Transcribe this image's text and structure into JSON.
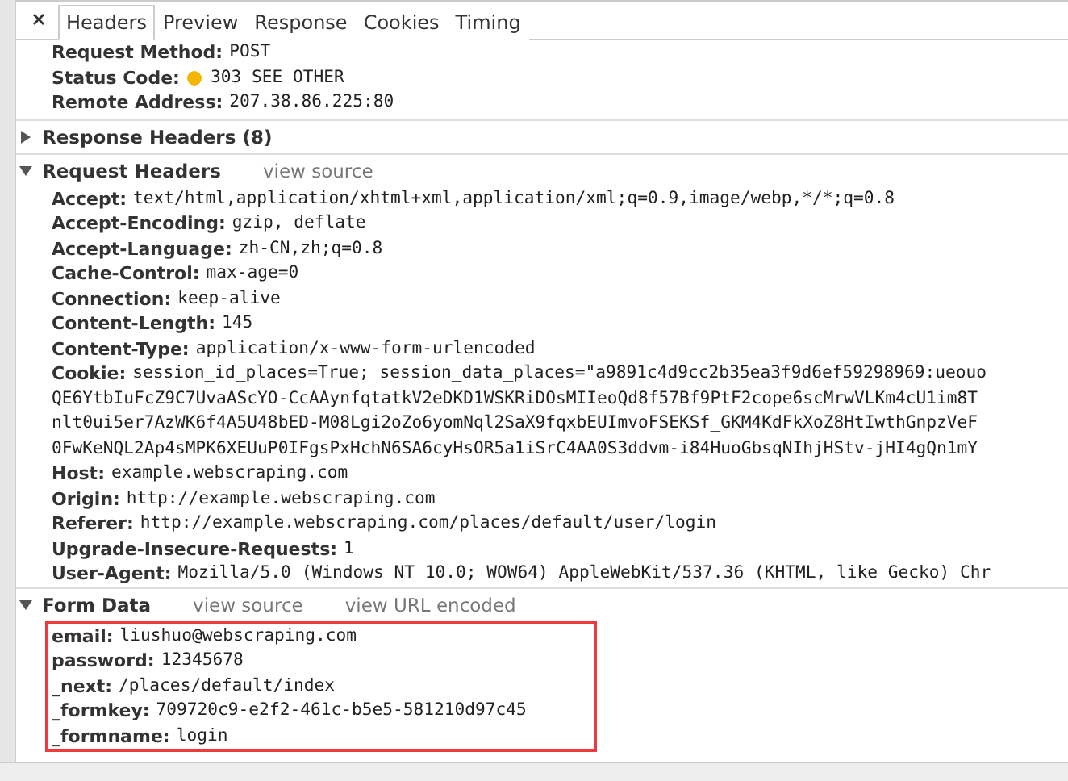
{
  "tabs": [
    {
      "label": "Headers",
      "selected": true
    },
    {
      "label": "Preview",
      "selected": false
    },
    {
      "label": "Response",
      "selected": false
    },
    {
      "label": "Cookies",
      "selected": false
    },
    {
      "label": "Timing",
      "selected": false
    }
  ],
  "general": [
    {
      "name": "Request Method:",
      "lines": [
        "POST"
      ]
    },
    {
      "name": "Status Code:",
      "lines": [
        "303 SEE OTHER"
      ],
      "status_dot": true
    },
    {
      "name": "Remote Address:",
      "lines": [
        "207.38.86.225:80"
      ]
    }
  ],
  "sections": [
    {
      "title": "Response Headers (8)",
      "expanded": false
    },
    {
      "title": "Request Headers",
      "expanded": true,
      "links": [
        "view source"
      ],
      "highlighted": false,
      "rows": [
        {
          "name": "Accept:",
          "lines": [
            "text/html,application/xhtml+xml,application/xml;q=0.9,image/webp,*/*;q=0.8"
          ]
        },
        {
          "name": "Accept-Encoding:",
          "lines": [
            "gzip, deflate"
          ]
        },
        {
          "name": "Accept-Language:",
          "lines": [
            "zh-CN,zh;q=0.8"
          ]
        },
        {
          "name": "Cache-Control:",
          "lines": [
            "max-age=0"
          ]
        },
        {
          "name": "Connection:",
          "lines": [
            "keep-alive"
          ]
        },
        {
          "name": "Content-Length:",
          "lines": [
            "145"
          ]
        },
        {
          "name": "Content-Type:",
          "lines": [
            "application/x-www-form-urlencoded"
          ]
        },
        {
          "name": "Cookie:",
          "lines": [
            "session_id_places=True; session_data_places=\"a9891c4d9cc2b35ea3f9d6ef59298969:ueouo",
            "QE6YtbIuFcZ9C7UvaAScYO-CcAAynfqtatkV2eDKD1WSKRiDOsMIIeoQd8f57Bf9PtF2cope6scMrwVLKm4cU1im8T",
            "nlt0ui5er7AzWK6f4A5U48bED-M08Lgi2oZo6yomNql2SaX9fqxbEUImvoFSEKSf_GKM4KdFkXoZ8HtIwthGnpzVeF",
            "0FwKeNQL2Ap4sMPK6XEUuP0IFgsPxHchN6SA6cyHsOR5a1iSrC4AA0S3ddvm-i84HuoGbsqNIhjHStv-jHI4gQn1mY"
          ]
        },
        {
          "name": "Host:",
          "lines": [
            "example.webscraping.com"
          ]
        },
        {
          "name": "Origin:",
          "lines": [
            "http://example.webscraping.com"
          ]
        },
        {
          "name": "Referer:",
          "lines": [
            "http://example.webscraping.com/places/default/user/login"
          ]
        },
        {
          "name": "Upgrade-Insecure-Requests:",
          "lines": [
            "1"
          ]
        },
        {
          "name": "User-Agent:",
          "lines": [
            "Mozilla/5.0 (Windows NT 10.0; WOW64) AppleWebKit/537.36 (KHTML, like Gecko) Chr"
          ]
        }
      ]
    },
    {
      "title": "Form Data",
      "expanded": true,
      "links": [
        "view source",
        "view URL encoded"
      ],
      "highlighted": true,
      "rows": [
        {
          "name": "email:",
          "lines": [
            "liushuo@webscraping.com"
          ]
        },
        {
          "name": "password:",
          "lines": [
            "12345678"
          ]
        },
        {
          "name": "_next:",
          "lines": [
            "/places/default/index"
          ]
        },
        {
          "name": "_formkey:",
          "lines": [
            "709720c9-e2f2-461c-b5e5-581210d97c45"
          ]
        },
        {
          "name": "_formname:",
          "lines": [
            "login"
          ]
        }
      ]
    }
  ]
}
